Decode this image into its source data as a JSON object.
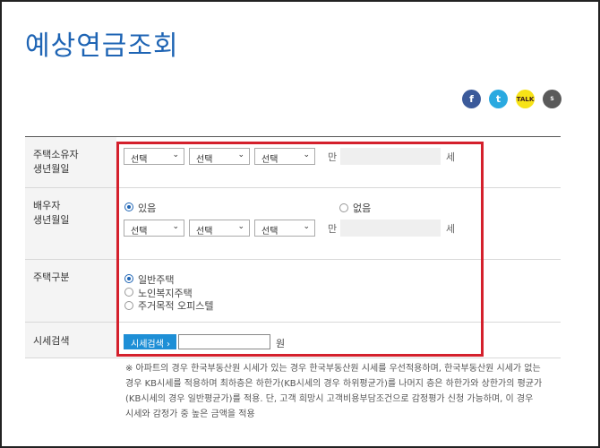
{
  "page": {
    "title": "예상연금조회"
  },
  "social": {
    "facebook": "f",
    "twitter": "t",
    "kakaotalk": "TALK",
    "kakaostory": "S"
  },
  "form": {
    "owner_birth": {
      "label_line1": "주택소유자",
      "label_line2": "생년월일",
      "selects": [
        "선택",
        "선택",
        "선택"
      ],
      "man_label": "만",
      "age_unit": "세"
    },
    "spouse_birth": {
      "label_line1": "배우자",
      "label_line2": "생년월일",
      "radio_yes": "있음",
      "radio_no": "없음",
      "selected": "있음",
      "selects": [
        "선택",
        "선택",
        "선택"
      ],
      "man_label": "만",
      "age_unit": "세"
    },
    "house_type": {
      "label": "주택구분",
      "options": [
        "일반주택",
        "노인복지주택",
        "주거목적 오피스텔"
      ],
      "selected": "일반주택"
    },
    "price_search": {
      "label": "시세검색",
      "button": "시세검색 ›",
      "value": "",
      "unit": "원"
    }
  },
  "note": {
    "line1": "※ 아파트의 경우 한국부동산원 시세가 있는 경우 한국부동산원 시세를 우선적용하며, 한국부동산원 시세가 없는",
    "line2": "경우 KB시세를 적용하며 최하층은 하한가(KB시세의 경우 하위평균가)를 나머지 층은 하한가와 상한가의 평균가",
    "line3": "(KB시세의 경우 일반평균가)를 적용. 단, 고객 희망시 고객비용부담조건으로 감정평가 신청 가능하며, 이 경우",
    "line4": "시세와 감정가 중 높은 금액을 적용"
  },
  "colors": {
    "title": "#1e64b4",
    "highlight_box": "#d4202c",
    "search_button": "#1e8fd6"
  }
}
